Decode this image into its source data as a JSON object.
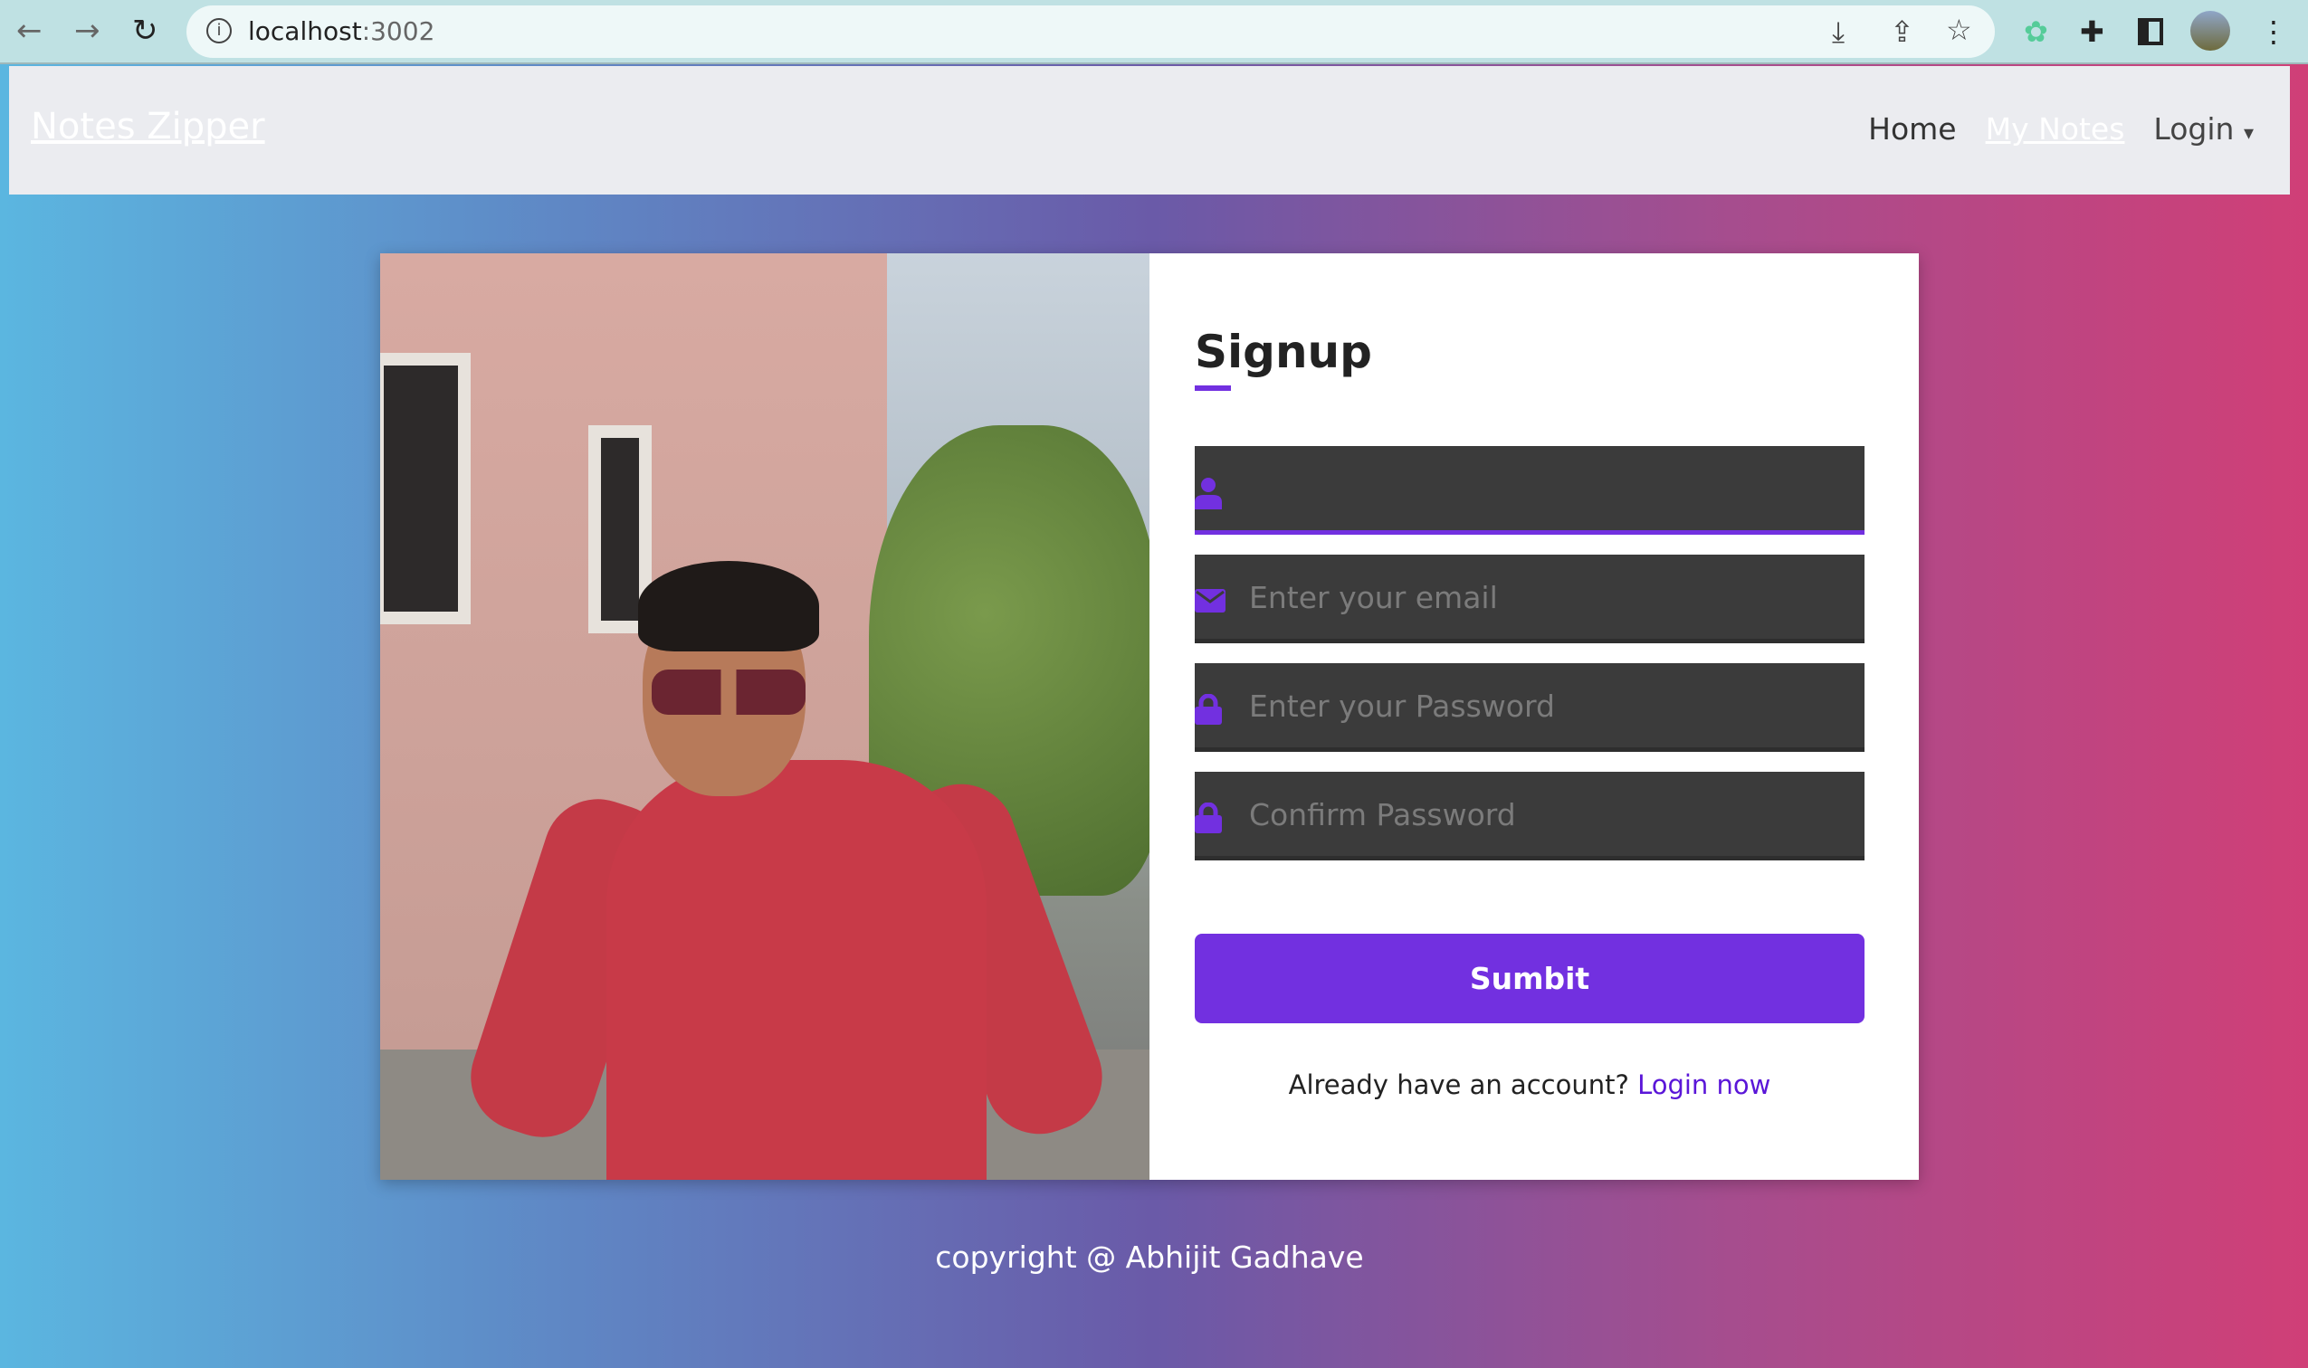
{
  "browser": {
    "url_host": "localhost",
    "url_port": ":3002"
  },
  "navbar": {
    "brand": "Notes Zipper",
    "links": {
      "home": "Home",
      "my_notes": "My Notes",
      "login": "Login"
    }
  },
  "signup": {
    "title": "Signup",
    "fields": [
      {
        "icon": "user-icon",
        "placeholder": "",
        "value": ""
      },
      {
        "icon": "envelope-icon",
        "placeholder": "Enter your email"
      },
      {
        "icon": "lock-icon",
        "placeholder": "Enter your Password"
      },
      {
        "icon": "lock-icon",
        "placeholder": "Confirm Password"
      }
    ],
    "submit_label": "Sumbit",
    "already_text": "Already have an account?",
    "login_link": "Login now"
  },
  "footer": {
    "text": "copyright @ Abhijit Gadhave"
  },
  "colors": {
    "accent": "#7230e0",
    "input_bg": "#3b3b3b",
    "gradient_left": "#5bb6e0",
    "gradient_right": "#d03f77"
  }
}
